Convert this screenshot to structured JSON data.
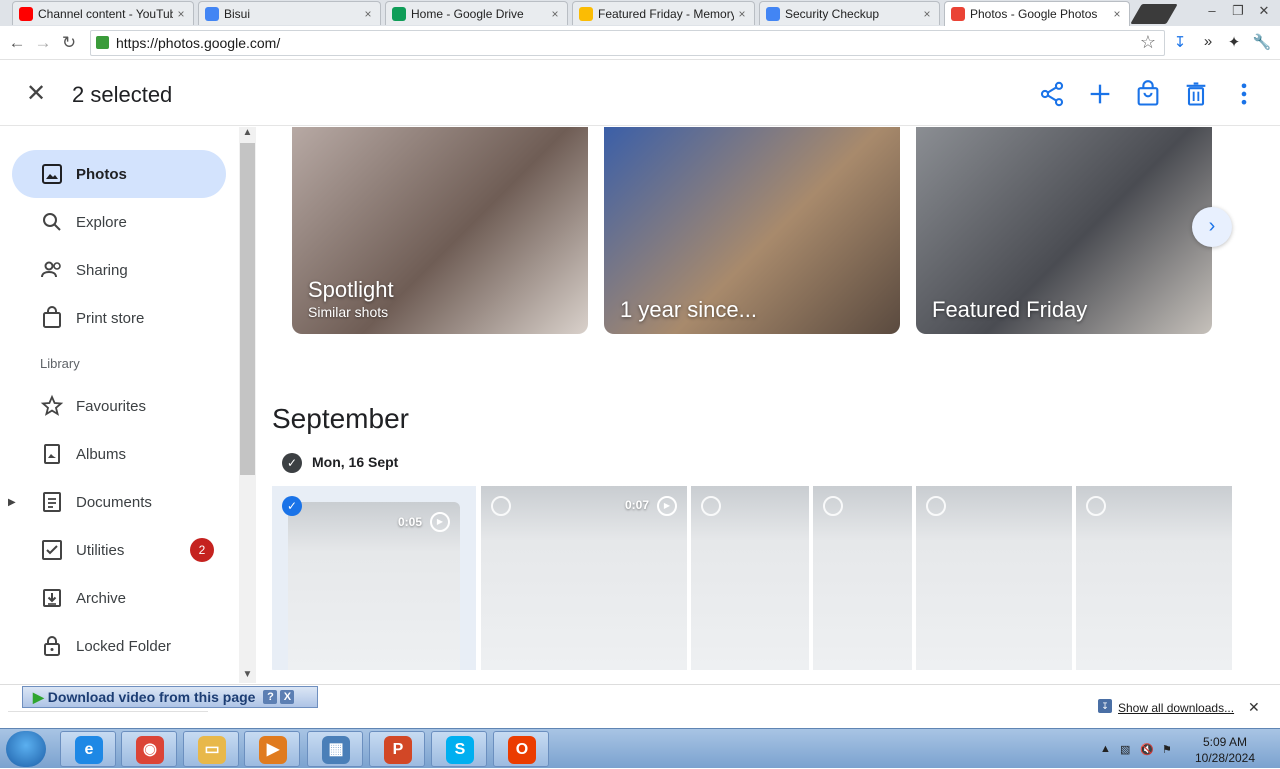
{
  "browser": {
    "tabs": [
      {
        "label": "Channel content - YouTube",
        "favicon": "youtube-icon",
        "color": "#ff0000",
        "active": false
      },
      {
        "label": "Bisui",
        "favicon": "google-g-icon",
        "color": "#4285f4",
        "active": false
      },
      {
        "label": "Home - Google Drive",
        "favicon": "google-drive-icon",
        "color": "#0f9d58",
        "active": false
      },
      {
        "label": "Featured Friday - Memory",
        "favicon": "google-photos-icon",
        "color": "#fbbc04",
        "active": false
      },
      {
        "label": "Security Checkup",
        "favicon": "google-g-icon",
        "color": "#4285f4",
        "active": false
      },
      {
        "label": "Photos - Google Photos",
        "favicon": "google-photos-icon",
        "color": "#ea4335",
        "active": true
      }
    ],
    "url": "https://photos.google.com/",
    "window_buttons": [
      "–",
      "❐",
      "✕"
    ]
  },
  "header": {
    "selection_count": "2 selected",
    "actions": [
      "share-icon",
      "add-icon",
      "print-order-icon",
      "delete-icon",
      "more-vert-icon"
    ]
  },
  "sidebar": {
    "items": [
      {
        "label": "Photos",
        "icon": "photos-icon",
        "active": true
      },
      {
        "label": "Explore",
        "icon": "search-icon"
      },
      {
        "label": "Sharing",
        "icon": "people-icon"
      },
      {
        "label": "Print store",
        "icon": "shopping-bag-icon"
      }
    ],
    "library_label": "Library",
    "library_items": [
      {
        "label": "Favourites",
        "icon": "star-icon"
      },
      {
        "label": "Albums",
        "icon": "album-icon"
      },
      {
        "label": "Documents",
        "icon": "document-icon",
        "expandable": true
      },
      {
        "label": "Utilities",
        "icon": "utilities-icon",
        "badge": "2"
      },
      {
        "label": "Archive",
        "icon": "archive-icon"
      },
      {
        "label": "Locked Folder",
        "icon": "lock-icon"
      }
    ]
  },
  "memories": [
    {
      "title": "Spotlight",
      "subtitle": "Similar shots",
      "colors": [
        "#b7a9a4",
        "#6f5d55",
        "#d9d1cb"
      ]
    },
    {
      "title": "1 year since...",
      "subtitle": "",
      "colors": [
        "#3b5fa8",
        "#a88a6c",
        "#5a4a3f"
      ]
    },
    {
      "title": "Featured Friday",
      "subtitle": "",
      "colors": [
        "#8b8e93",
        "#4a4c52",
        "#c6c1bb"
      ]
    }
  ],
  "timeline": {
    "month": "September",
    "day_label": "Mon, 16 Sept",
    "thumbs": [
      {
        "selected": true,
        "duration": "0:05"
      },
      {
        "selected": false,
        "duration": "0:07"
      },
      {
        "selected": false,
        "duration": ""
      },
      {
        "selected": false,
        "duration": ""
      },
      {
        "selected": false,
        "duration": ""
      },
      {
        "selected": false,
        "duration": ""
      }
    ]
  },
  "download_widget": {
    "label": "Download video from this page",
    "help": "?",
    "close": "X"
  },
  "downloads_shelf": {
    "show_all": "Show all downloads...",
    "close": "✕"
  },
  "taskbar": {
    "apps": [
      {
        "name": "internet-explorer-icon",
        "glyph": "e",
        "color": "#1e88e5"
      },
      {
        "name": "chrome-icon",
        "glyph": "◉",
        "color": "#db4437"
      },
      {
        "name": "file-explorer-icon",
        "glyph": "▭",
        "color": "#e8b84a"
      },
      {
        "name": "media-player-icon",
        "glyph": "▶",
        "color": "#e07b1f"
      },
      {
        "name": "remote-desktop-icon",
        "glyph": "▦",
        "color": "#4a7fb8"
      },
      {
        "name": "powerpoint-icon",
        "glyph": "P",
        "color": "#d24726"
      },
      {
        "name": "skype-icon",
        "glyph": "S",
        "color": "#00aff0"
      },
      {
        "name": "office-icon",
        "glyph": "O",
        "color": "#eb3c00"
      }
    ],
    "time": "5:09 AM",
    "date": "10/28/2024"
  }
}
